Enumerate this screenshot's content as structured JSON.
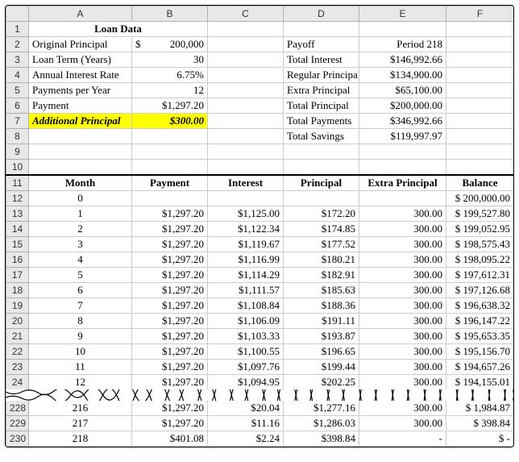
{
  "columns": [
    "A",
    "B",
    "C",
    "D",
    "E",
    "F"
  ],
  "loan_data_header": "Loan Data",
  "labels": {
    "orig_principal": "Original Principal",
    "loan_term": "Loan Term (Years)",
    "annual_rate": "Annual Interest Rate",
    "pmts_per_year": "Payments per Year",
    "payment": "Payment",
    "addl_principal": "Additional Principal",
    "payoff": "Payoff",
    "total_interest": "Total Interest",
    "regular_principal": "Regular Principal",
    "extra_principal": "Extra Principal",
    "total_principal": "Total Principal",
    "total_payments": "Total Payments",
    "total_savings": "Total Savings"
  },
  "values": {
    "orig_principal_sym": "$",
    "orig_principal": "200,000",
    "loan_term": "30",
    "annual_rate": "6.75%",
    "pmts_per_year": "12",
    "payment": "$1,297.20",
    "addl_principal": "$300.00",
    "payoff": "Period 218",
    "total_interest": "$146,992.66",
    "regular_principal": "$134,900.00",
    "extra_principal": "$65,100.00",
    "total_principal": "$200,000.00",
    "total_payments": "$346,992.66",
    "total_savings": "$119,997.97"
  },
  "table_headers": {
    "month": "Month",
    "payment": "Payment",
    "interest": "Interest",
    "principal": "Principal",
    "extra_principal": "Extra Principal",
    "balance": "Balance"
  },
  "chart_data": {
    "type": "table",
    "columns": [
      "Month",
      "Payment",
      "Interest",
      "Principal",
      "Extra Principal",
      "Balance"
    ],
    "rows_top": [
      {
        "row": 12,
        "month": "0",
        "payment": "",
        "interest": "",
        "principal": "",
        "extra": "",
        "balance": "$ 200,000.00"
      },
      {
        "row": 13,
        "month": "1",
        "payment": "$1,297.20",
        "interest": "$1,125.00",
        "principal": "$172.20",
        "extra": "300.00",
        "balance": "$ 199,527.80"
      },
      {
        "row": 14,
        "month": "2",
        "payment": "$1,297.20",
        "interest": "$1,122.34",
        "principal": "$174.85",
        "extra": "300.00",
        "balance": "$ 199,052.95"
      },
      {
        "row": 15,
        "month": "3",
        "payment": "$1,297.20",
        "interest": "$1,119.67",
        "principal": "$177.52",
        "extra": "300.00",
        "balance": "$ 198,575.43"
      },
      {
        "row": 16,
        "month": "4",
        "payment": "$1,297.20",
        "interest": "$1,116.99",
        "principal": "$180.21",
        "extra": "300.00",
        "balance": "$ 198,095.22"
      },
      {
        "row": 17,
        "month": "5",
        "payment": "$1,297.20",
        "interest": "$1,114.29",
        "principal": "$182.91",
        "extra": "300.00",
        "balance": "$ 197,612.31"
      },
      {
        "row": 18,
        "month": "6",
        "payment": "$1,297.20",
        "interest": "$1,111.57",
        "principal": "$185.63",
        "extra": "300.00",
        "balance": "$ 197,126.68"
      },
      {
        "row": 19,
        "month": "7",
        "payment": "$1,297.20",
        "interest": "$1,108.84",
        "principal": "$188.36",
        "extra": "300.00",
        "balance": "$ 196,638.32"
      },
      {
        "row": 20,
        "month": "8",
        "payment": "$1,297.20",
        "interest": "$1,106.09",
        "principal": "$191.11",
        "extra": "300.00",
        "balance": "$ 196,147.22"
      },
      {
        "row": 21,
        "month": "9",
        "payment": "$1,297.20",
        "interest": "$1,103.33",
        "principal": "$193.87",
        "extra": "300.00",
        "balance": "$ 195,653.35"
      },
      {
        "row": 22,
        "month": "10",
        "payment": "$1,297.20",
        "interest": "$1,100.55",
        "principal": "$196.65",
        "extra": "300.00",
        "balance": "$ 195,156.70"
      },
      {
        "row": 23,
        "month": "11",
        "payment": "$1,297.20",
        "interest": "$1,097.76",
        "principal": "$199.44",
        "extra": "300.00",
        "balance": "$ 194,657.26"
      },
      {
        "row": 24,
        "month": "12",
        "payment": "$1,297.20",
        "interest": "$1,094.95",
        "principal": "$202.25",
        "extra": "300.00",
        "balance": "$ 194,155.01"
      }
    ],
    "rows_bottom": [
      {
        "row": 228,
        "month": "216",
        "payment": "$1,297.20",
        "interest": "$20.04",
        "principal": "$1,277.16",
        "extra": "300.00",
        "balance": "$     1,984.87"
      },
      {
        "row": 229,
        "month": "217",
        "payment": "$1,297.20",
        "interest": "$11.16",
        "principal": "$1,286.03",
        "extra": "300.00",
        "balance": "$        398.84"
      },
      {
        "row": 230,
        "month": "218",
        "payment": "$401.08",
        "interest": "$2.24",
        "principal": "$398.84",
        "extra": "-",
        "balance": "$               -"
      }
    ]
  }
}
